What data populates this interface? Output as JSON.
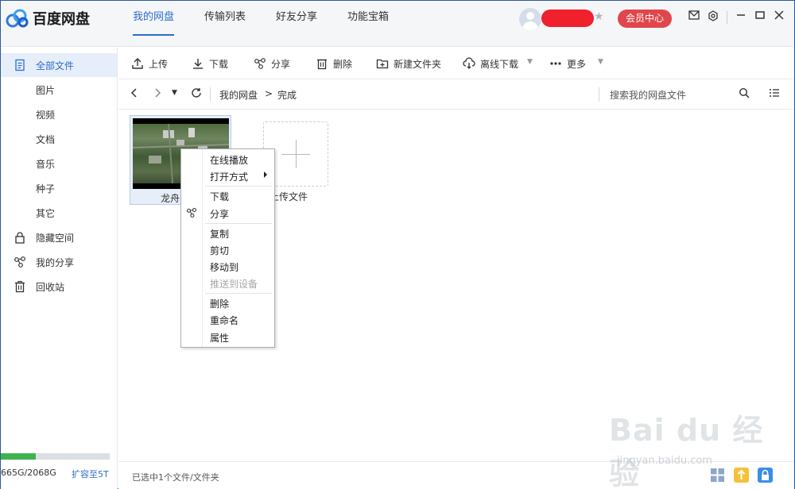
{
  "app": {
    "title": "百度网盘"
  },
  "nav": {
    "tabs": [
      {
        "label": "我的网盘"
      },
      {
        "label": "传输列表"
      },
      {
        "label": "好友分享"
      },
      {
        "label": "功能宝箱"
      }
    ],
    "vip_label": "会员中心"
  },
  "sidebar": {
    "items": [
      {
        "label": "全部文件",
        "icon": "file-list-icon"
      },
      {
        "label": "图片"
      },
      {
        "label": "视频"
      },
      {
        "label": "文档"
      },
      {
        "label": "音乐"
      },
      {
        "label": "种子"
      },
      {
        "label": "其它"
      },
      {
        "label": "隐藏空间",
        "icon": "lock-icon"
      },
      {
        "label": "我的分享",
        "icon": "share-icon"
      },
      {
        "label": "回收站",
        "icon": "trash-icon"
      }
    ],
    "quota_text": "665G/2068G",
    "quota_fraction": 0.32,
    "upgrade_label": "扩容至5T"
  },
  "toolbar": {
    "upload": "上传",
    "download": "下载",
    "share": "分享",
    "delete": "删除",
    "new_folder": "新建文件夹",
    "offline_download": "离线下载",
    "more": "更多"
  },
  "pathbar": {
    "crumbs": [
      "我的网盘",
      "完成"
    ],
    "separator": ">",
    "search_placeholder": "搜索我的网盘文件"
  },
  "files": [
    {
      "name": "龙舟 无人"
    }
  ],
  "upload_card_label": "上传文件",
  "context_menu": {
    "items": [
      "在线播放",
      "打开方式",
      "下载",
      "分享",
      "复制",
      "剪切",
      "移动到",
      "推送到设备",
      "删除",
      "重命名",
      "属性"
    ]
  },
  "status": {
    "text": "已选中1个文件/文件夹"
  },
  "watermark": {
    "main": "Bai du 经验",
    "sub": "jingyan.baidu.com"
  },
  "colors": {
    "accent": "#2d6dcc",
    "vip": "#e0464a",
    "quota": "#3fb34f"
  }
}
